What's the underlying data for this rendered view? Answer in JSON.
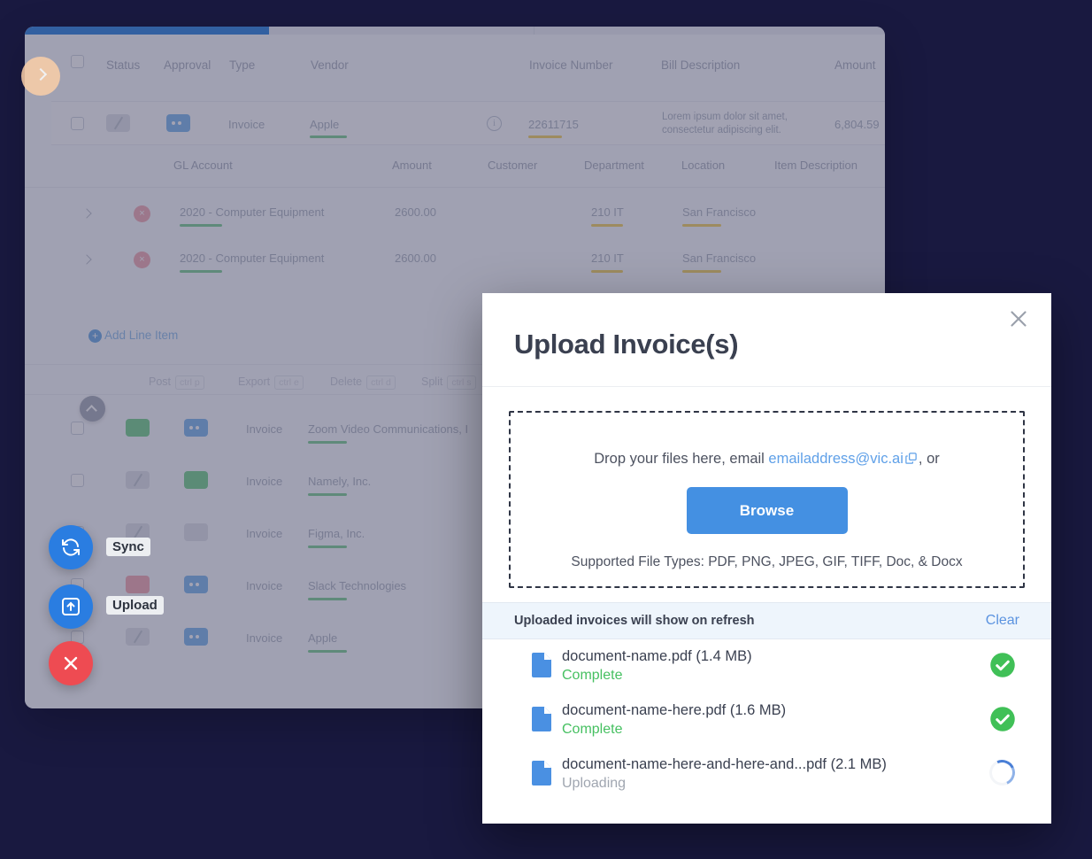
{
  "theme": {
    "page_bg": "#191940",
    "accent_blue": "#4490e2",
    "success_green": "#46c061",
    "danger_red": "#ee4b52"
  },
  "background_app": {
    "table_headers": [
      "Status",
      "Approval",
      "Type",
      "Vendor",
      "Invoice Number",
      "Bill Description",
      "Amount"
    ],
    "invoice_row": {
      "type": "Invoice",
      "vendor": "Apple",
      "invoice_number": "22611715",
      "bill_description_line1": "Lorem ipsum dolor sit amet,",
      "bill_description_line2": "consectetur adipiscing elit.",
      "amount": "6,804.59"
    },
    "line_item_headers": [
      "GL Account",
      "Amount",
      "Customer",
      "Department",
      "Location",
      "Item Description"
    ],
    "line_items": [
      {
        "gl_account": "2020 - Computer Equipment",
        "amount": "2600.00",
        "customer": "",
        "department": "210 IT",
        "location": "San Francisco",
        "item_description": ""
      },
      {
        "gl_account": "2020 - Computer Equipment",
        "amount": "2600.00",
        "customer": "",
        "department": "210 IT",
        "location": "San Francisco",
        "item_description": ""
      }
    ],
    "add_line_item_label": "Add Line Item",
    "toolbar": [
      {
        "label": "Post",
        "shortcut": "ctrl p"
      },
      {
        "label": "Export",
        "shortcut": "ctrl e"
      },
      {
        "label": "Delete",
        "shortcut": "ctrl d"
      },
      {
        "label": "Split",
        "shortcut": "ctrl s"
      }
    ],
    "invoice_rows": [
      {
        "type": "Invoice",
        "vendor": "Zoom Video Communications, I"
      },
      {
        "type": "Invoice",
        "vendor": "Namely, Inc."
      },
      {
        "type": "Invoice",
        "vendor": "Figma, Inc."
      },
      {
        "type": "Invoice",
        "vendor": "Slack Technologies"
      },
      {
        "type": "Invoice",
        "vendor": "Apple"
      }
    ],
    "fabs": [
      {
        "name": "sync",
        "label": "Sync"
      },
      {
        "name": "upload",
        "label": "Upload"
      },
      {
        "name": "close",
        "label": ""
      }
    ]
  },
  "modal": {
    "title": "Upload Invoice(s)",
    "dropzone": {
      "text_before": "Drop your files here, email ",
      "email": "emailaddress@vic.ai",
      "text_after": ", or",
      "browse_label": "Browse",
      "supported": "Supported File Types: PDF, PNG, JPEG, GIF, TIFF, Doc, & Docx"
    },
    "list_header": {
      "title": "Uploaded invoices will show on refresh",
      "clear_label": "Clear"
    },
    "files": [
      {
        "name": "document-name.pdf (1.4 MB)",
        "status": "Complete",
        "state": "done"
      },
      {
        "name": "document-name-here.pdf (1.6 MB)",
        "status": "Complete",
        "state": "done"
      },
      {
        "name": "document-name-here-and-here-and...pdf (2.1 MB)",
        "status": "Uploading",
        "state": "loading"
      }
    ]
  }
}
